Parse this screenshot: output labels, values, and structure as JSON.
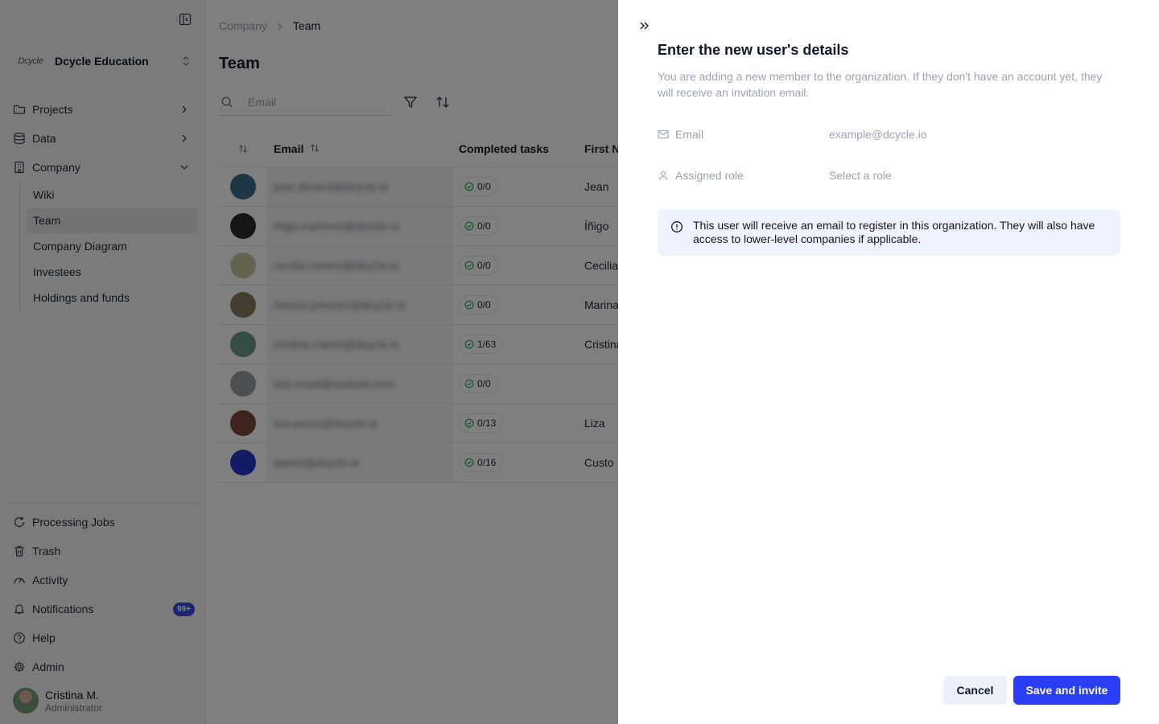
{
  "sidebar": {
    "org": {
      "logo_text": "Dcycle",
      "name": "Dcycle Education"
    },
    "nav": [
      {
        "label": "Projects",
        "icon": "folder-icon"
      },
      {
        "label": "Data",
        "icon": "database-icon"
      },
      {
        "label": "Company",
        "icon": "building-icon"
      }
    ],
    "company_sub": [
      {
        "label": "Wiki"
      },
      {
        "label": "Team"
      },
      {
        "label": "Company Diagram"
      },
      {
        "label": "Investees"
      },
      {
        "label": "Holdings and funds"
      }
    ],
    "bottom": [
      {
        "label": "Processing Jobs",
        "icon": "refresh-icon"
      },
      {
        "label": "Trash",
        "icon": "trash-icon"
      },
      {
        "label": "Activity",
        "icon": "gauge-icon"
      },
      {
        "label": "Notifications",
        "icon": "bell-icon",
        "badge": "99+"
      },
      {
        "label": "Help",
        "icon": "help-circle-icon"
      },
      {
        "label": "Admin",
        "icon": "gear-icon"
      }
    ],
    "user": {
      "name": "Cristina M.",
      "role": "Administrator"
    }
  },
  "main": {
    "breadcrumb": {
      "parent": "Company",
      "current": "Team"
    },
    "title": "Team",
    "search": {
      "placeholder": "Email",
      "value": ""
    },
    "table": {
      "headers": {
        "email": "Email",
        "tasks": "Completed tasks",
        "first_name": "First N"
      },
      "rows": [
        {
          "email": "jean.durand@dcycle.io",
          "tasks": "0/0",
          "first_name": "Jean",
          "avatar_color": "#3b6e8f"
        },
        {
          "email": "inigo.martinez@dcycle.io",
          "tasks": "0/0",
          "first_name": "Íñigo",
          "avatar_color": "#2b2b2b"
        },
        {
          "email": "cecilia.romero@dcycle.io",
          "tasks": "0/0",
          "first_name": "Cecilia",
          "avatar_color": "#c8c6a0"
        },
        {
          "email": "marina.jimenez@dcycle.io",
          "tasks": "0/0",
          "first_name": "Marina",
          "avatar_color": "#8a7a60"
        },
        {
          "email": "cristina.martin@dcycle.io",
          "tasks": "1/63",
          "first_name": "Cristina",
          "avatar_color": "#6a9a8a"
        },
        {
          "email": "test.email@outlook.com",
          "tasks": "0/0",
          "first_name": "",
          "avatar_color": "#9aa0a6"
        },
        {
          "email": "liza.perez@dcycle.io",
          "tasks": "0/13",
          "first_name": "Liza",
          "avatar_color": "#7a4a3a"
        },
        {
          "email": "admin@dcycle.io",
          "tasks": "0/16",
          "first_name": "Custo",
          "avatar_color": "#2436c8"
        }
      ]
    }
  },
  "drawer": {
    "title": "Enter the new user's details",
    "description": "You are adding a new member to the organization. If they don't have an account yet, they will receive an invitation email.",
    "email": {
      "label": "Email",
      "placeholder": "example@dcycle.io",
      "value": ""
    },
    "role": {
      "label": "Assigned role",
      "placeholder": "Select a role"
    },
    "info": "This user will receive an email to register in this organization. They will also have access to lower-level companies if applicable.",
    "cancel_label": "Cancel",
    "save_label": "Save and invite"
  },
  "colors": {
    "accent": "#2a3ff5",
    "badge": "#3348ea",
    "info_bg": "#eef3fd",
    "overlay": "rgba(0,0,0,0.5)"
  }
}
